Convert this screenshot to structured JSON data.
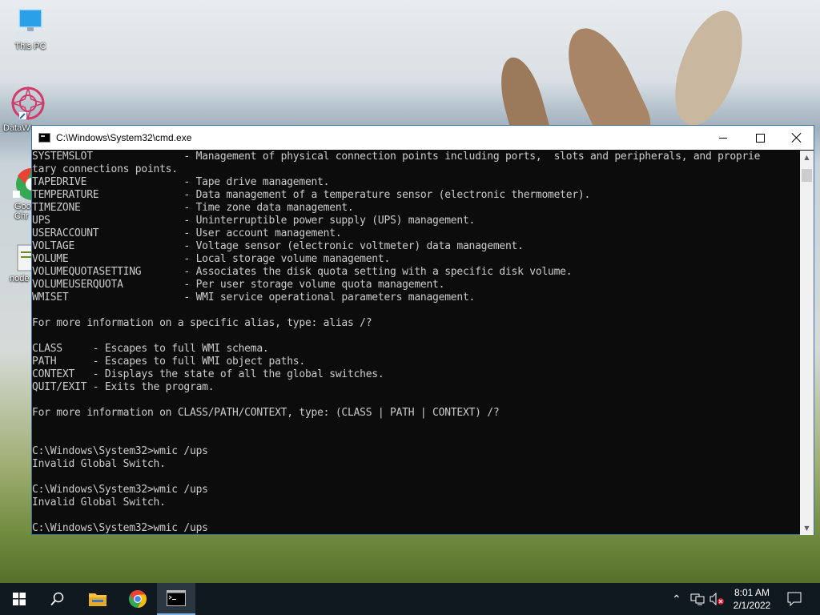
{
  "desktop": {
    "icons": [
      {
        "label": "This PC"
      },
      {
        "label": "DataW"
      },
      {
        "label": "Goo\nChr"
      },
      {
        "label": "node"
      }
    ]
  },
  "window": {
    "title": "C:\\Windows\\System32\\cmd.exe",
    "console_lines": [
      "SYSTEMSLOT               - Management of physical connection points including ports,  slots and peripherals, and proprie",
      "tary connections points.",
      "TAPEDRIVE                - Tape drive management.",
      "TEMPERATURE              - Data management of a temperature sensor (electronic thermometer).",
      "TIMEZONE                 - Time zone data management.",
      "UPS                      - Uninterruptible power supply (UPS) management.",
      "USERACCOUNT              - User account management.",
      "VOLTAGE                  - Voltage sensor (electronic voltmeter) data management.",
      "VOLUME                   - Local storage volume management.",
      "VOLUMEQUOTASETTING       - Associates the disk quota setting with a specific disk volume.",
      "VOLUMEUSERQUOTA          - Per user storage volume quota management.",
      "WMISET                   - WMI service operational parameters management.",
      "",
      "For more information on a specific alias, type: alias /?",
      "",
      "CLASS     - Escapes to full WMI schema.",
      "PATH      - Escapes to full WMI object paths.",
      "CONTEXT   - Displays the state of all the global switches.",
      "QUIT/EXIT - Exits the program.",
      "",
      "For more information on CLASS/PATH/CONTEXT, type: (CLASS | PATH | CONTEXT) /?",
      "",
      "",
      "C:\\Windows\\System32>wmic /ups",
      "Invalid Global Switch.",
      "",
      "C:\\Windows\\System32>wmic /ups",
      "Invalid Global Switch.",
      "",
      "C:\\Windows\\System32>wmic /ups"
    ]
  },
  "taskbar": {
    "clock_time": "8:01 AM",
    "clock_date": "2/1/2022",
    "pinned": [
      "start-icon",
      "search-icon",
      "file-explorer-icon",
      "chrome-icon",
      "cmd-icon"
    ]
  },
  "colors": {
    "console_bg": "#0c0c0c",
    "console_fg": "#cccccc",
    "taskbar_bg": "#101820"
  }
}
